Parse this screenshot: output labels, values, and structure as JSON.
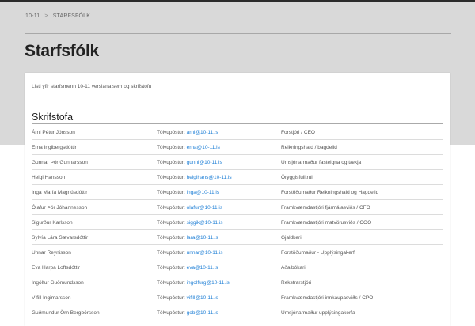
{
  "breadcrumb": {
    "home": "10-11",
    "separator": ">",
    "current": "Starfsfólk"
  },
  "page": {
    "title": "Starfsfólk",
    "intro": "Listi yfir starfsmenn 10-11 verslana sem og skrifstofu"
  },
  "section": {
    "title": "Skrifstofa",
    "email_prefix": "Tölvupóstur:"
  },
  "staff": [
    {
      "name": "Árni Pétur Jónsson",
      "email": "arni@10-11.is",
      "title": "Forstjóri / CEO"
    },
    {
      "name": "Erna Ingibergsdóttir",
      "email": "erna@10-11.is",
      "title": "Reikningshald / bagdeild"
    },
    {
      "name": "Gunnar Þór Gunnarsson",
      "email": "gunni@10-11.is",
      "title": "Umsjónarmaður fasteigna og tækja"
    },
    {
      "name": "Helgi Hansson",
      "email": "helgihans@10-11.is",
      "title": "Öryggisfulltrúi"
    },
    {
      "name": "Inga María Magnúsdóttir",
      "email": "inga@10-11.is",
      "title": "Forstöðumaður Reikningshald og Hagdeild"
    },
    {
      "name": "Ólafur Þór Jóhannesson",
      "email": "olafur@10-11.is",
      "title": "Framkvæmdastjóri fjármálasviðs / CFO"
    },
    {
      "name": "Sigurður Karlsson",
      "email": "siggik@10-11.is",
      "title": "Framkvæmdastjóri matvörusviðs / COO"
    },
    {
      "name": "Sylvía Lára Sævarsdóttir",
      "email": "lara@10-11.is",
      "title": "Gjaldkeri"
    },
    {
      "name": "Unnar Reynisson",
      "email": "unnar@10-11.is",
      "title": "Forstöðumaður - Upplýsingakerfi"
    },
    {
      "name": "Eva Harpa Loftsdóttir",
      "email": "eva@10-11.is",
      "title": "Aðalbókari"
    },
    {
      "name": "Ingólfur Guðmundsson",
      "email": "ingolfurg@10-11.is",
      "title": "Rekstrarstjóri"
    },
    {
      "name": "Vífill Ingimarsson",
      "email": "vifill@10-11.is",
      "title": "Framkvæmdastjóri innkaupasviðs / CPO"
    },
    {
      "name": "Guðmundur Örn Bergbórsson",
      "email": "gob@10-11.is",
      "title": "Umsjónarmaður upplýsingakerfa"
    }
  ]
}
